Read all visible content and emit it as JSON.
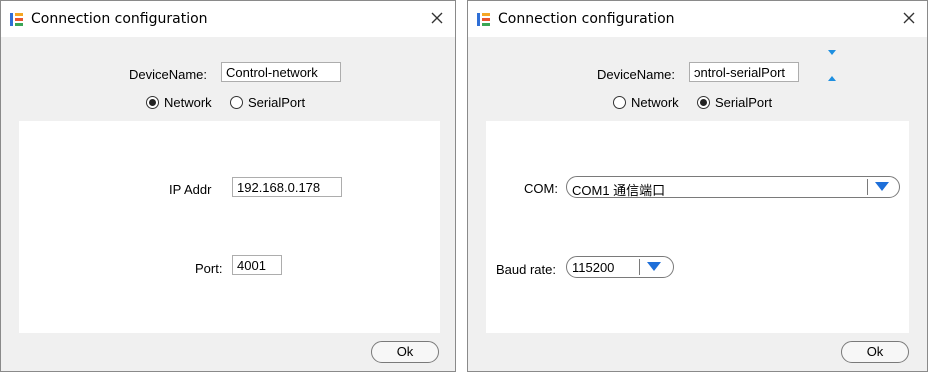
{
  "dialog1": {
    "title": "Connection configuration",
    "device_name_label": "DeviceName:",
    "device_name_value": "Control-network",
    "radio_network_label": "Network",
    "radio_serial_label": "SerialPort",
    "selected": "Network",
    "ip_label": "IP Addr",
    "ip_value": "192.168.0.178",
    "port_label": "Port:",
    "port_value": "4001",
    "ok_label": "Ok"
  },
  "dialog2": {
    "title": "Connection configuration",
    "device_name_label": "DeviceName:",
    "device_name_value": "ɔntrol-serialPort",
    "radio_network_label": "Network",
    "radio_serial_label": "SerialPort",
    "selected": "SerialPort",
    "com_label": "COM:",
    "com_value": "COM1 通信端口",
    "baud_label": "Baud rate:",
    "baud_value": "115200",
    "ok_label": "Ok"
  },
  "colors": {
    "dialog_bg": "#f0f0f0",
    "panel_bg": "#ffffff",
    "accent": "#1e6fd9"
  },
  "icons": {
    "app": "app-logo-icon",
    "close": "close-icon",
    "dropdown": "chevron-down-icon"
  }
}
